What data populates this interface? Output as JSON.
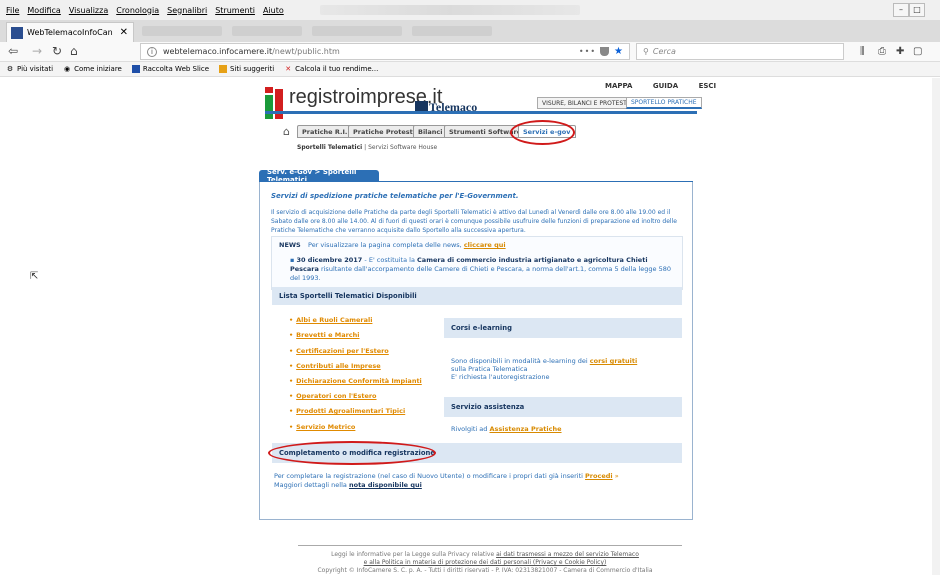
{
  "browser": {
    "menu": [
      "File",
      "Modifica",
      "Visualizza",
      "Cronologia",
      "Segnalibri",
      "Strumenti",
      "Aiuto"
    ],
    "tab_title": "WebTelemacoInfoCan",
    "tab_close": "✕",
    "url_host": "webtelemaco.infocamere.it",
    "url_path": "/newt/public.htm",
    "url_dots": "•••",
    "search_placeholder": "Cerca",
    "bookmarks": [
      "Più visitati",
      "Come iniziare",
      "Raccolta Web Slice",
      "Siti suggeriti",
      "Calcola il tuo rendime..."
    ]
  },
  "site": {
    "logo_text": "registroimprese.it",
    "telemaco_label": "Telemaco",
    "top_links": [
      "MAPPA",
      "GUIDA",
      "ESCI"
    ],
    "portal_tabs": [
      "VISURE, BILANCI E PROTESTI",
      "SPORTELLO PRATICHE"
    ],
    "section_tabs": [
      "Pratiche R.I.",
      "Pratiche Protesti",
      "Bilanci",
      "Strumenti Software",
      "Servizi e-gov"
    ],
    "subnav_active": "Sportelli Telematici",
    "subnav_sep": "|",
    "subnav_other": "Servizi Software House"
  },
  "panel": {
    "tab_label": "Serv. e-Gov > Sportelli Telematici",
    "intro_title": "Servizi di spedizione pratiche telematiche per l'E-Government.",
    "intro_body": "Il servizio di acquisizione delle Pratiche da parte degli Sportelli Telematici è attivo dal Lunedì al Venerdì dalle ore 8.00 alle 19.00 ed il Sabato dalle ore 8.00 alle 14.00. Al di fuori di questi orari è comunque possibile usufruire delle funzioni di preparazione ed inoltro delle Pratiche Telematiche che verranno acquisite dallo Sportello alla successiva apertura.",
    "news_label": "NEWS",
    "news_text": "Per visualizzare la pagina completa delle news,",
    "news_link": "cliccare qui",
    "news_date": "30 dicembre 2017",
    "news_dash": "- E' costituita la",
    "news_bold": "Camera di commercio industria artigianato e agricoltura Chieti Pescara",
    "news_rest": "risultante dall'accorpamento delle Camere di Chieti e Pescara, a norma dell'art.1, comma 5 della legge 580 del 1993.",
    "list_header": "Lista Sportelli Telematici Disponibili",
    "list_items": [
      "Albi e Ruoli Camerali",
      "Brevetti e Marchi",
      "Certificazioni per l'Estero",
      "Contributi alle Imprese",
      "Dichiarazione Conformità Impianti",
      "Operatori con l'Estero",
      "Prodotti Agroalimentari Tipici",
      "Servizio Metrico"
    ],
    "courses_header": "Corsi e-learning",
    "courses_text1": "Sono disponibili in modalità e-learning dei",
    "courses_link": "corsi gratuiti",
    "courses_text2": "sulla Pratica Telematica",
    "courses_text3": "E' richiesta l'autoregistrazione",
    "assist_header": "Servizio assistenza",
    "assist_text": "Rivolgiti ad",
    "assist_link": "Assistenza Pratiche",
    "complete_header": "Completamento o modifica registrazione",
    "complete_text": "Per completare la registrazione (nel caso di Nuovo Utente) o modificare i propri dati già inseriti",
    "proceed_link": "Procedi",
    "proceed_arrow": "»",
    "details_text": "Maggiori dettagli nella",
    "details_link": "nota disponibile qui"
  },
  "footer": {
    "line1_text": "Leggi le informative per la Legge sulla Privacy relative",
    "line1_link": "ai dati trasmessi a mezzo del servizio Telemaco",
    "line2_link": "e alla Politica in materia di protezione dei dati personali (Privacy e Cookie Policy)",
    "line3": "Copyright © InfoCamere S. C. p. A. - Tutti i diritti riservati - P. IVA: 02313821007 - Camera di Commercio d'Italia"
  }
}
